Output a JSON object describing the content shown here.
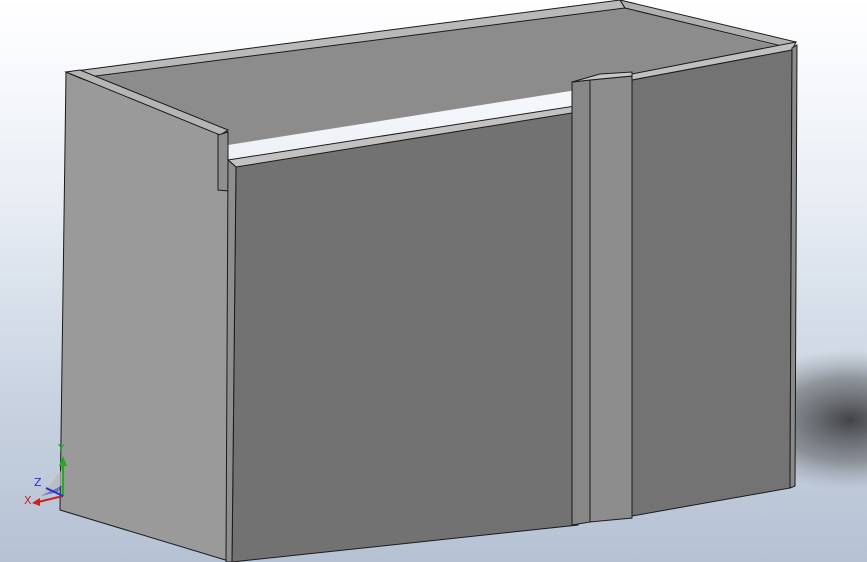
{
  "viewport": {
    "background_top": "#ffffff",
    "background_bottom": "#b5c2d4"
  },
  "model": {
    "name": "open-box-with-rib",
    "face_colors": {
      "light": "#979797",
      "mid": "#8a8a8a",
      "dark": "#737373",
      "inner_back": "#8e8e8e",
      "edge": "#1a1a1a"
    }
  },
  "triad": {
    "x_label": "X",
    "y_label": "Y",
    "z_label": "Z",
    "x_color": "#cc2222",
    "y_color": "#22aa22",
    "z_color": "#2233cc"
  }
}
